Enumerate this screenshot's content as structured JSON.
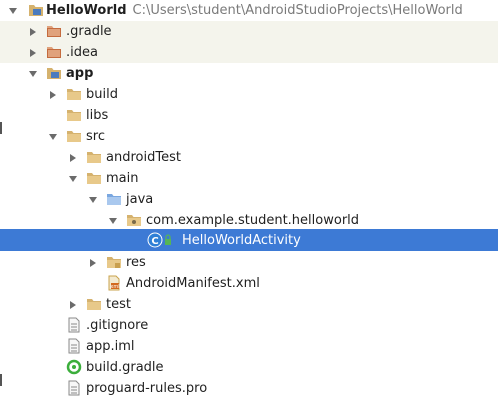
{
  "tree": {
    "root": {
      "label": "HelloWorld",
      "path": "C:\\Users\\student\\AndroidStudioProjects\\HelloWorld"
    },
    "gradle_dir": ".gradle",
    "idea_dir": ".idea",
    "app": "app",
    "build": "build",
    "libs": "libs",
    "src": "src",
    "androidTest": "androidTest",
    "main": "main",
    "java": "java",
    "package": "com.example.student.helloworld",
    "activity": "HelloWorldActivity",
    "res": "res",
    "manifest": "AndroidManifest.xml",
    "test": "test",
    "gitignore": ".gitignore",
    "app_iml": "app.iml",
    "build_gradle": "build.gradle",
    "proguard": "proguard-rules.pro"
  },
  "colors": {
    "selection": "#3d7ad5",
    "excluded_folder_highlight": "#f4f4ec",
    "folder": "#d5b26e",
    "java_source_folder": "#7aa7e0",
    "class_icon": "#2f7fd6",
    "gradle_icon": "#3cae3c"
  },
  "icons": {
    "folder": "folder-icon",
    "excluded_folder": "excluded-folder-icon",
    "module": "module-folder-icon",
    "source_folder": "source-folder-icon",
    "package": "package-icon",
    "class": "class-icon",
    "manifest": "xml-manifest-icon",
    "text_file": "text-file-icon",
    "gradle": "gradle-icon"
  }
}
